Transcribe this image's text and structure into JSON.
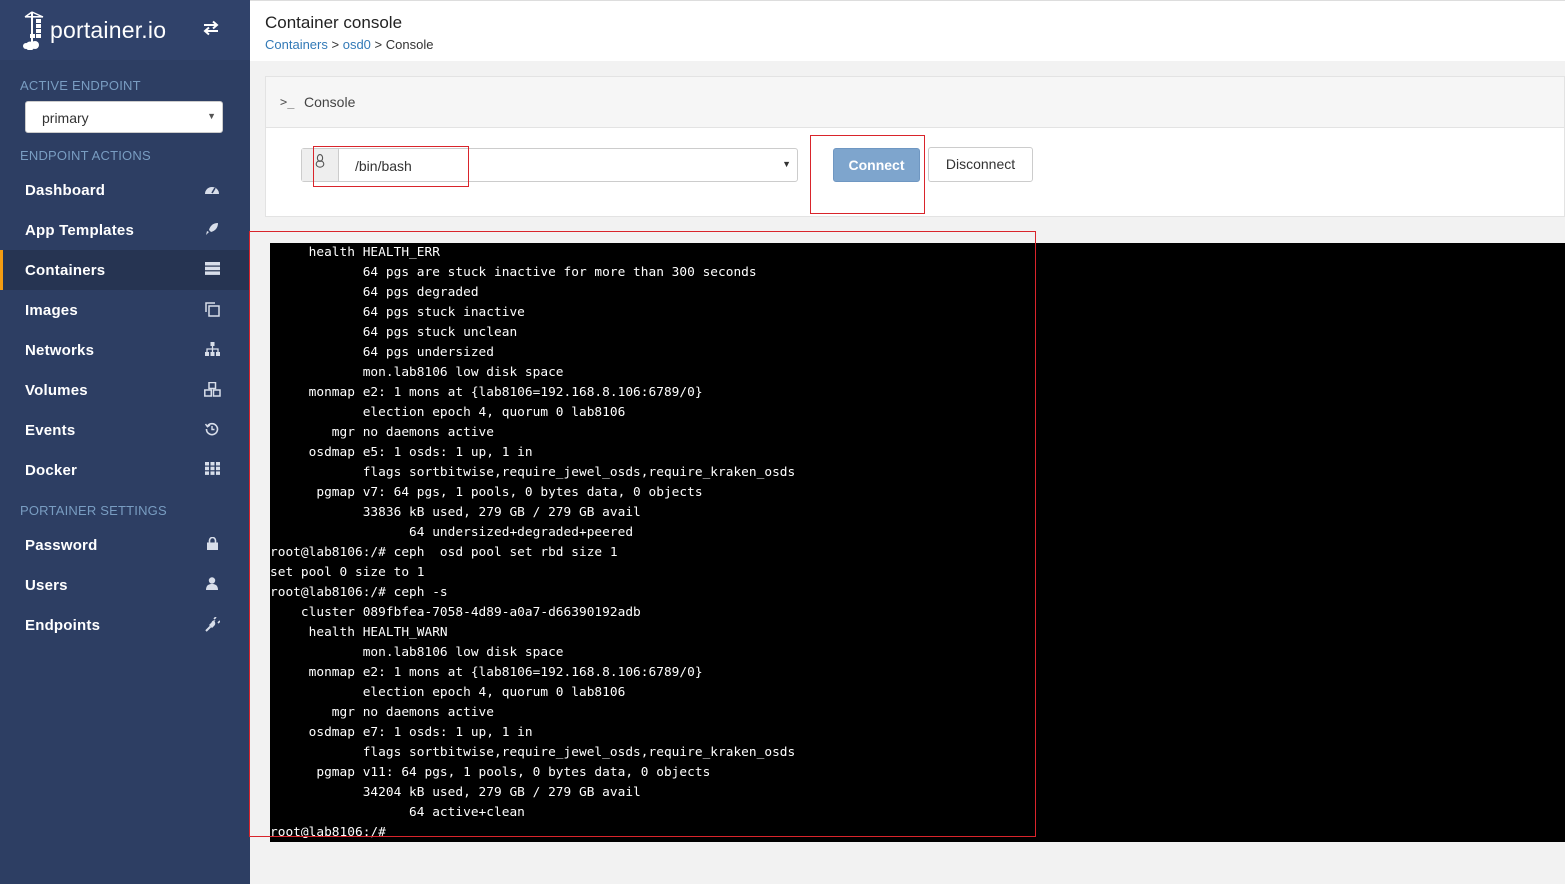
{
  "brand": {
    "name": "portainer.io"
  },
  "sidebar": {
    "active_endpoint_title": "ACTIVE ENDPOINT",
    "endpoint_value": "primary",
    "endpoint_actions_title": "ENDPOINT ACTIONS",
    "items": [
      {
        "label": "Dashboard",
        "icon": "dashboard-icon"
      },
      {
        "label": "App Templates",
        "icon": "rocket-icon"
      },
      {
        "label": "Containers",
        "icon": "server-icon",
        "active": true
      },
      {
        "label": "Images",
        "icon": "clone-icon"
      },
      {
        "label": "Networks",
        "icon": "sitemap-icon"
      },
      {
        "label": "Volumes",
        "icon": "cubes-icon"
      },
      {
        "label": "Events",
        "icon": "history-icon"
      },
      {
        "label": "Docker",
        "icon": "th-icon"
      }
    ],
    "portainer_settings_title": "PORTAINER SETTINGS",
    "settings_items": [
      {
        "label": "Password",
        "icon": "lock-icon"
      },
      {
        "label": "Users",
        "icon": "user-icon"
      },
      {
        "label": "Endpoints",
        "icon": "plug-icon"
      }
    ]
  },
  "header": {
    "title": "Container console",
    "breadcrumbs": [
      "Containers",
      "osd0",
      "Console"
    ],
    "separator": ">"
  },
  "console_panel": {
    "title": "Console",
    "command_value": "/bin/bash",
    "connect_label": "Connect",
    "disconnect_label": "Disconnect"
  },
  "terminal": {
    "lines": [
      "     health HEALTH_ERR",
      "            64 pgs are stuck inactive for more than 300 seconds",
      "            64 pgs degraded",
      "            64 pgs stuck inactive",
      "            64 pgs stuck unclean",
      "            64 pgs undersized",
      "            mon.lab8106 low disk space",
      "     monmap e2: 1 mons at {lab8106=192.168.8.106:6789/0}",
      "            election epoch 4, quorum 0 lab8106",
      "        mgr no daemons active",
      "     osdmap e5: 1 osds: 1 up, 1 in",
      "            flags sortbitwise,require_jewel_osds,require_kraken_osds",
      "      pgmap v7: 64 pgs, 1 pools, 0 bytes data, 0 objects",
      "            33836 kB used, 279 GB / 279 GB avail",
      "                  64 undersized+degraded+peered",
      "root@lab8106:/# ceph  osd pool set rbd size 1",
      "set pool 0 size to 1",
      "root@lab8106:/# ceph -s",
      "    cluster 089fbfea-7058-4d89-a0a7-d66390192adb",
      "     health HEALTH_WARN",
      "            mon.lab8106 low disk space",
      "     monmap e2: 1 mons at {lab8106=192.168.8.106:6789/0}",
      "            election epoch 4, quorum 0 lab8106",
      "        mgr no daemons active",
      "     osdmap e7: 1 osds: 1 up, 1 in",
      "            flags sortbitwise,require_jewel_osds,require_kraken_osds",
      "      pgmap v11: 64 pgs, 1 pools, 0 bytes data, 0 objects",
      "            34204 kB used, 279 GB / 279 GB avail",
      "                  64 active+clean",
      "root@lab8106:/# "
    ]
  },
  "colors": {
    "sidebar_bg": "#2d3e63",
    "active_accent": "#f39c12",
    "link": "#337ab7",
    "annotation_red": "#d9242b"
  }
}
